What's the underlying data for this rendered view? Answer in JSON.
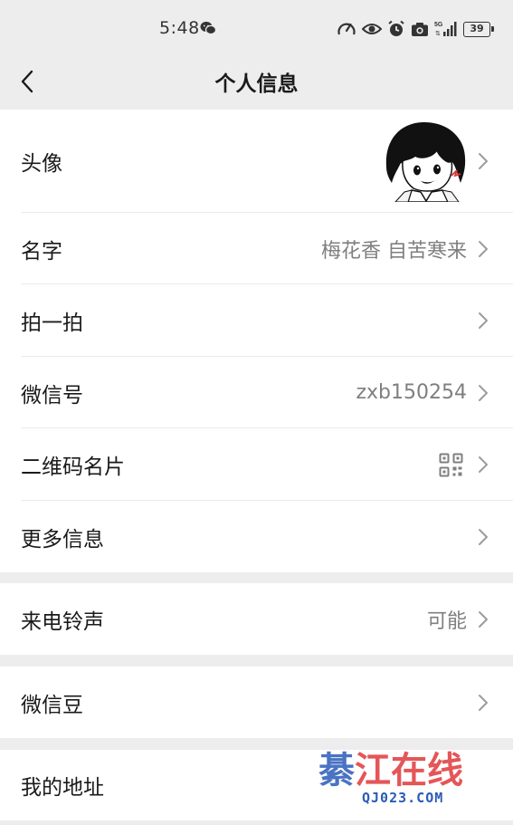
{
  "status_bar": {
    "time": "5:48",
    "battery": "39",
    "icons": [
      "wechat-icon",
      "speedometer-icon",
      "eye-icon",
      "alarm-icon",
      "camera-icon",
      "signal-icon",
      "battery-icon"
    ]
  },
  "nav": {
    "title": "个人信息",
    "back_icon": "chevron-left-icon"
  },
  "profile": {
    "avatar_label": "头像",
    "name_label": "名字",
    "name_value": "梅花香 自苦寒来",
    "pat_label": "拍一拍",
    "wechat_id_label": "微信号",
    "wechat_id_value": "zxb150254",
    "qr_label": "二维码名片",
    "more_label": "更多信息"
  },
  "ringtone": {
    "label": "来电铃声",
    "value": "可能"
  },
  "beans": {
    "label": "微信豆"
  },
  "address": {
    "label": "我的地址"
  },
  "watermark": {
    "title": "綦江在线",
    "url": "QJ023.COM"
  },
  "colors": {
    "background": "#ededed",
    "card": "#ffffff",
    "secondary_text": "#7f7f7f",
    "watermark_red": "#e0393c",
    "watermark_blue": "#2b5bb8"
  }
}
